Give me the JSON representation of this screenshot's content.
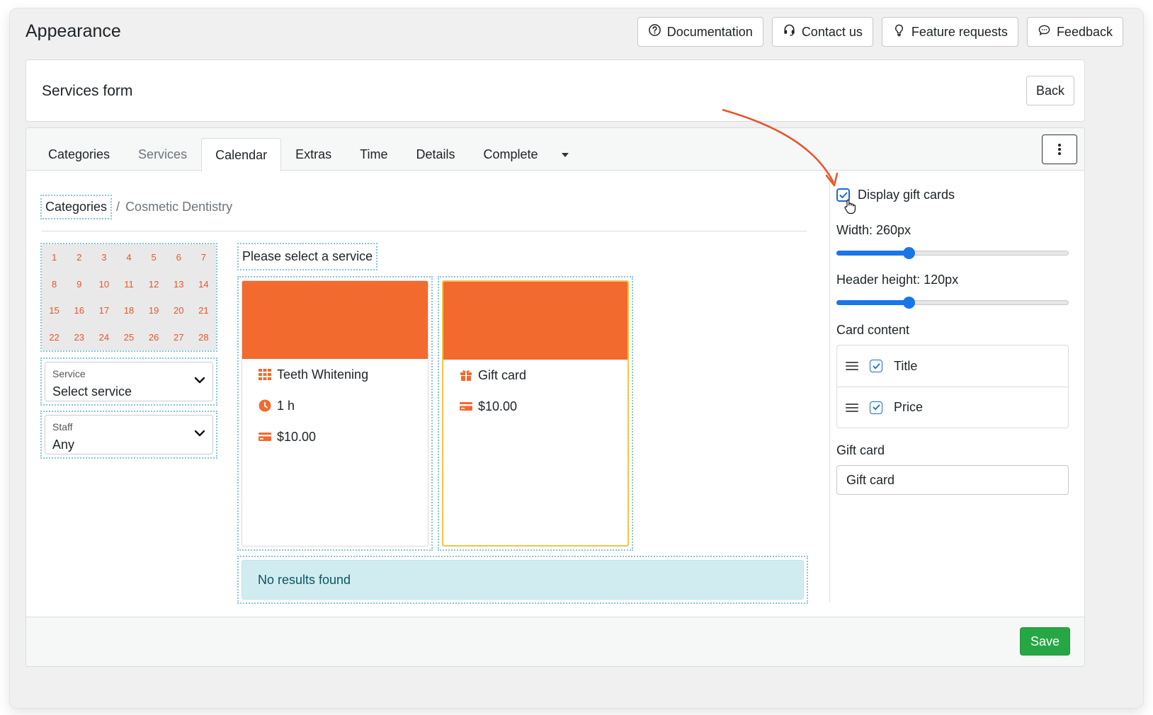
{
  "page": {
    "title": "Appearance"
  },
  "header_buttons": [
    {
      "label": "Documentation",
      "icon": "question-circle-icon"
    },
    {
      "label": "Contact us",
      "icon": "headset-icon"
    },
    {
      "label": "Feature requests",
      "icon": "lightbulb-icon"
    },
    {
      "label": "Feedback",
      "icon": "chat-bubble-icon"
    }
  ],
  "form_header": {
    "title": "Services form",
    "back_label": "Back"
  },
  "tabs": [
    {
      "label": "Categories",
      "state": "normal"
    },
    {
      "label": "Services",
      "state": "muted"
    },
    {
      "label": "Calendar",
      "state": "active"
    },
    {
      "label": "Extras",
      "state": "normal"
    },
    {
      "label": "Time",
      "state": "normal"
    },
    {
      "label": "Details",
      "state": "normal"
    },
    {
      "label": "Complete",
      "state": "normal"
    }
  ],
  "breadcrumb": {
    "root": "Categories",
    "separator": "/",
    "current": "Cosmetic Dentistry"
  },
  "calendar_days": [
    1,
    2,
    3,
    4,
    5,
    6,
    7,
    8,
    9,
    10,
    11,
    12,
    13,
    14,
    15,
    16,
    17,
    18,
    19,
    20,
    21,
    22,
    23,
    24,
    25,
    26,
    27,
    28
  ],
  "service_select": {
    "label": "Service",
    "value": "Select service"
  },
  "staff_select": {
    "label": "Staff",
    "value": "Any"
  },
  "prompt": "Please select a service",
  "service_cards": [
    {
      "title": "Teeth Whitening",
      "duration": "1 h",
      "price": "$10.00"
    },
    {
      "title": "Gift card",
      "price": "$10.00"
    }
  ],
  "no_results": "No results found",
  "settings": {
    "display_gift_cards": {
      "label": "Display gift cards",
      "checked": true
    },
    "width": {
      "label": "Width: 260px",
      "value": 260,
      "fraction": 0.31
    },
    "header_height": {
      "label": "Header height: 120px",
      "value": 120,
      "fraction": 0.31
    },
    "card_content_label": "Card content",
    "card_content": [
      {
        "label": "Title",
        "checked": true
      },
      {
        "label": "Price",
        "checked": true
      }
    ],
    "gift_card_label": "Gift card",
    "gift_card_value": "Gift card"
  },
  "footer": {
    "save_label": "Save"
  },
  "colors": {
    "accent_orange": "#f26a2e",
    "calendar_day": "#e8552a",
    "slider_blue": "#1976e8",
    "save_green": "#27a744",
    "selected_border": "#f6c344",
    "info_bg": "#d1ecf1"
  }
}
